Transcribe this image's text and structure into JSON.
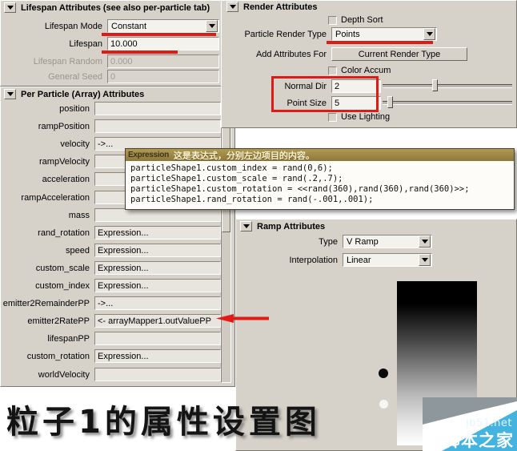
{
  "colors": {
    "panel_bg": "#d6d2c9",
    "field_bg": "#e8e5de",
    "annotation_red": "#e01b15",
    "tooltip_gold": "#9c8845",
    "watermark_blue": "#44b3e0"
  },
  "lifespan_section": {
    "title": "Lifespan Attributes (see also per-particle tab)",
    "rows": [
      {
        "label": "Lifespan Mode",
        "value": "Constant",
        "type": "combo",
        "disabled": false
      },
      {
        "label": "Lifespan",
        "value": "10.000",
        "type": "text",
        "disabled": false
      },
      {
        "label": "Lifespan Random",
        "value": "0.000",
        "type": "text",
        "disabled": true
      },
      {
        "label": "General Seed",
        "value": "0",
        "type": "text",
        "disabled": true
      }
    ]
  },
  "per_particle_section": {
    "title": "Per Particle (Array) Attributes",
    "rows": [
      {
        "label": "position",
        "value": ""
      },
      {
        "label": "rampPosition",
        "value": ""
      },
      {
        "label": "velocity",
        "value": "->..."
      },
      {
        "label": "rampVelocity",
        "value": ""
      },
      {
        "label": "acceleration",
        "value": ""
      },
      {
        "label": "rampAcceleration",
        "value": ""
      },
      {
        "label": "mass",
        "value": ""
      },
      {
        "label": "rand_rotation",
        "value": "Expression..."
      },
      {
        "label": "speed",
        "value": "Expression..."
      },
      {
        "label": "custom_scale",
        "value": "Expression..."
      },
      {
        "label": "custom_index",
        "value": "Expression..."
      },
      {
        "label": "emitter2RemainderPP",
        "value": "->..."
      },
      {
        "label": "emitter2RatePP",
        "value": "<- arrayMapper1.outValuePP"
      },
      {
        "label": "lifespanPP",
        "value": ""
      },
      {
        "label": "custom_rotation",
        "value": "Expression..."
      },
      {
        "label": "worldVelocity",
        "value": ""
      }
    ]
  },
  "render_section": {
    "title": "Render Attributes",
    "depth_sort": {
      "label": "Depth Sort",
      "checked": false
    },
    "particle_render_type": {
      "label": "Particle Render Type",
      "value": "Points"
    },
    "add_attributes_for": {
      "label": "Add Attributes For",
      "button": "Current Render Type"
    },
    "color_accum": {
      "label": "Color Accum",
      "checked": false
    },
    "normal_dir": {
      "label": "Normal Dir",
      "value": "2"
    },
    "point_size": {
      "label": "Point Size",
      "value": "5"
    },
    "use_lighting": {
      "label": "Use Lighting",
      "checked": false
    }
  },
  "ramp_section": {
    "title": "Ramp Attributes",
    "type": {
      "label": "Type",
      "value": "V Ramp"
    },
    "interpolation": {
      "label": "Interpolation",
      "value": "Linear"
    }
  },
  "expression_window": {
    "title": "Expression",
    "note": "这是表达式，分别左边项目的内容。",
    "lines": [
      "particleShape1.custom_index = rand(0,6);",
      "particleShape1.custom_scale = rand(.2,.7);",
      "particleShape1.custom_rotation = <<rand(360),rand(360),rand(360)>>;",
      "particleShape1.rand_rotation = rand(-.001,.001);"
    ]
  },
  "caption": {
    "text": "粒子1的属性设置图"
  },
  "watermark": {
    "site": "jb51.net",
    "name": "脚本之家"
  }
}
